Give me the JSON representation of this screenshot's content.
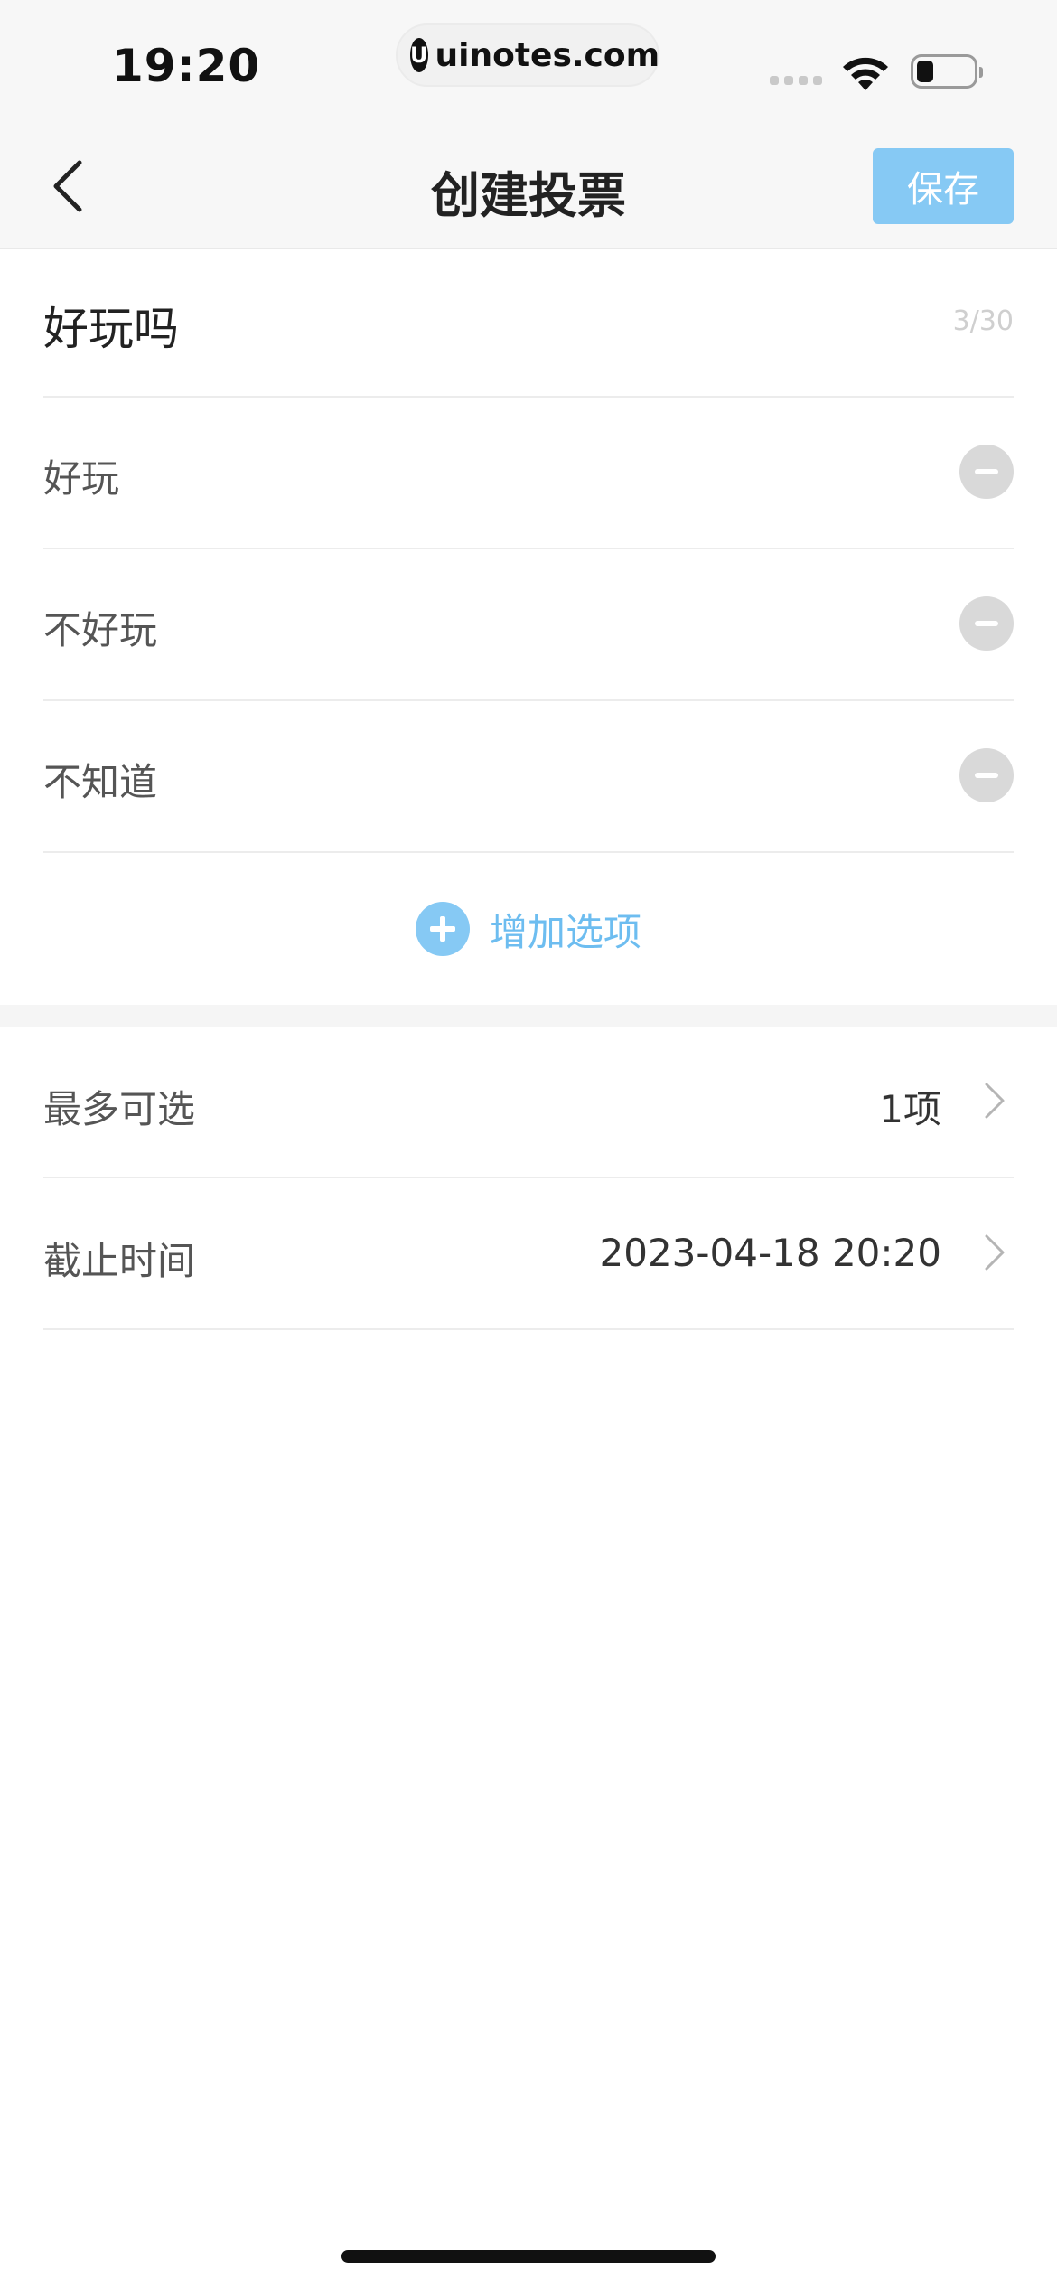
{
  "status_bar": {
    "time": "19:20",
    "url": "uinotes.com",
    "url_logo": "U"
  },
  "nav": {
    "title": "创建投票",
    "save_label": "保存",
    "back_icon": "chevron-left-icon"
  },
  "poll": {
    "title": "好玩吗",
    "title_count": "3/30",
    "options": [
      {
        "label": "好玩"
      },
      {
        "label": "不好玩"
      },
      {
        "label": "不知道"
      }
    ],
    "add_option_label": "增加选项"
  },
  "settings": {
    "max_select": {
      "label": "最多可选",
      "value": "1项"
    },
    "deadline": {
      "label": "截止时间",
      "value": "2023-04-18 20:20"
    }
  },
  "colors": {
    "accent": "#86c9f4",
    "accent_text": "#6dbdf0",
    "remove_button": "#d9d9d9"
  }
}
